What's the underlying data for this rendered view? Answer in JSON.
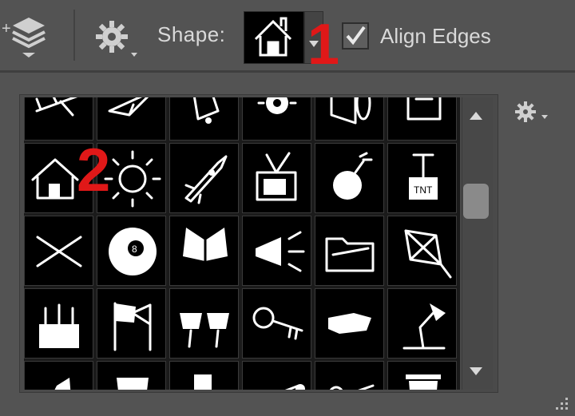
{
  "options_bar": {
    "shape_label": "Shape:",
    "align_edges_label": "Align Edges",
    "align_edges_checked": true
  },
  "annotations": [
    "1",
    "2"
  ],
  "shape_picker": {
    "selected_index": 6,
    "shapes": [
      "airplane-shape-icon",
      "paper-plane-shape-icon",
      "hand-bell-shape-icon",
      "cog-flower-shape-icon",
      "speaker-shape-icon",
      "scroll-shape-icon",
      "house-shape-icon",
      "sun-shape-icon",
      "rocket-shape-icon",
      "tv-shape-icon",
      "bomb-shape-icon",
      "tnt-plunger-shape-icon",
      "crossed-bandage-shape-icon",
      "eight-ball-shape-icon",
      "butterfly-shape-icon",
      "megaphone-shape-icon",
      "folder-shape-icon",
      "kite-shape-icon",
      "birthday-cake-shape-icon",
      "flags-shape-icon",
      "sunglasses-shape-icon",
      "key-shape-icon",
      "hand-pointing-shape-icon",
      "desk-lamp-shape-icon",
      "witch-hat-shape-icon",
      "cup-shape-icon",
      "boot-shape-icon",
      "bone-shape-icon",
      "scissors-shape-icon",
      "trash-can-shape-icon"
    ]
  },
  "colors": {
    "panel_bg": "#535353",
    "grid_bg": "#000000",
    "annotation": "#e01818",
    "text": "#d9d9d9"
  }
}
